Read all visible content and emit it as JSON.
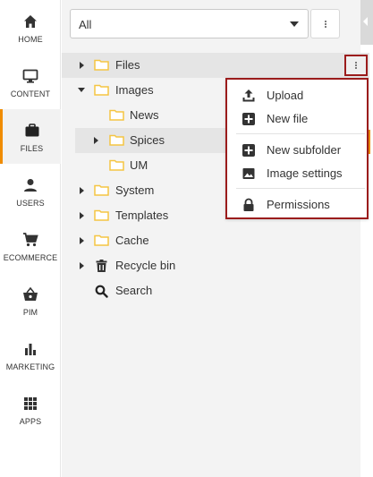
{
  "nav": {
    "items": [
      {
        "label": "HOME",
        "icon": "home-icon"
      },
      {
        "label": "CONTENT",
        "icon": "monitor-icon"
      },
      {
        "label": "FILES",
        "icon": "briefcase-icon",
        "active": true
      },
      {
        "label": "USERS",
        "icon": "user-icon"
      },
      {
        "label": "ECOMMERCE",
        "icon": "cart-icon"
      },
      {
        "label": "PIM",
        "icon": "basket-icon"
      },
      {
        "label": "MARKETING",
        "icon": "bar-chart-icon"
      },
      {
        "label": "APPS",
        "icon": "grid-icon"
      }
    ],
    "accent": "#f08c00"
  },
  "filter": {
    "selected": "All"
  },
  "tree": [
    {
      "label": "Files",
      "icon": "folder-icon",
      "expander": "collapsed"
    },
    {
      "label": "Images",
      "icon": "folder-icon",
      "expander": "expanded"
    },
    {
      "label": "News",
      "icon": "folder-icon",
      "expander": "none"
    },
    {
      "label": "Spices",
      "icon": "folder-icon",
      "expander": "collapsed"
    },
    {
      "label": "UM",
      "icon": "folder-icon",
      "expander": "none"
    },
    {
      "label": "System",
      "icon": "folder-icon",
      "expander": "collapsed"
    },
    {
      "label": "Templates",
      "icon": "folder-icon",
      "expander": "collapsed"
    },
    {
      "label": "Cache",
      "icon": "folder-icon",
      "expander": "collapsed"
    },
    {
      "label": "Recycle bin",
      "icon": "trash-icon",
      "expander": "collapsed"
    },
    {
      "label": "Search",
      "icon": "search-icon",
      "expander": "none"
    }
  ],
  "context_menu": {
    "items": [
      {
        "label": "Upload",
        "icon": "upload-icon"
      },
      {
        "label": "New file",
        "icon": "plus-box-icon"
      },
      {
        "label": "New subfolder",
        "icon": "plus-box-icon"
      },
      {
        "label": "Image settings",
        "icon": "image-icon"
      },
      {
        "label": "Permissions",
        "icon": "lock-icon"
      }
    ],
    "border_color": "#9b1c1c"
  },
  "colors": {
    "folder": "#f5c542",
    "accent": "#f08c00",
    "highlight_border": "#9b1c1c"
  }
}
